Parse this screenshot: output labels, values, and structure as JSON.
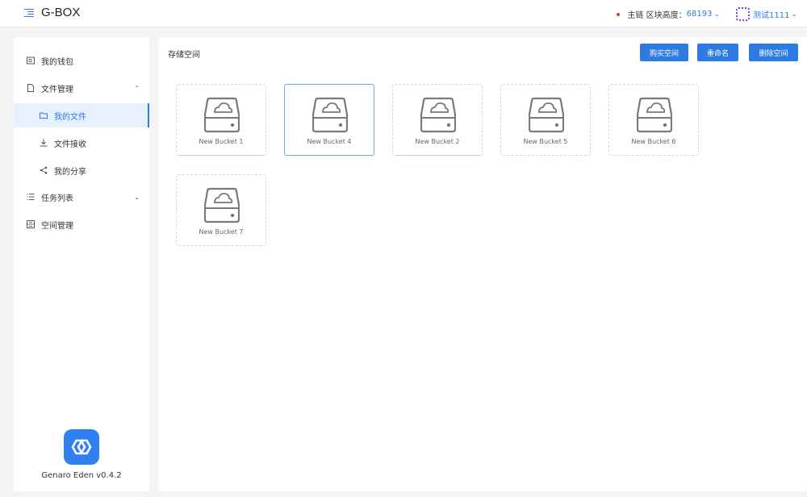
{
  "header": {
    "app_title": "G-BOX",
    "block_height_label": "主链 区块高度：",
    "block_height_value": "68193",
    "user_name": "测试1111"
  },
  "sidebar": {
    "items": [
      {
        "label": "我的钱包",
        "icon": "wallet-icon"
      },
      {
        "label": "文件管理",
        "icon": "file-icon",
        "expanded": true
      },
      {
        "label": "我的文件",
        "icon": "folder-icon",
        "active": true
      },
      {
        "label": "文件接收",
        "icon": "download-icon"
      },
      {
        "label": "我的分享",
        "icon": "share-icon"
      },
      {
        "label": "任务列表",
        "icon": "list-icon",
        "expanded": false
      },
      {
        "label": "空间管理",
        "icon": "storage-icon"
      }
    ],
    "version": "Genaro Eden v0.4.2"
  },
  "main": {
    "title": "存储空间",
    "buttons": {
      "buy": "购买空间",
      "rename": "重命名",
      "delete": "删除空间"
    },
    "buckets": [
      {
        "name": "New Bucket 1"
      },
      {
        "name": "New Bucket 4",
        "selected": true
      },
      {
        "name": "New Bucket 2"
      },
      {
        "name": "New Bucket 5"
      },
      {
        "name": "New Bucket 6"
      },
      {
        "name": "New Bucket 7"
      }
    ]
  },
  "colors": {
    "accent": "#2d7be0",
    "active_bg": "#e6f1fd",
    "status_dot": "#e53935",
    "avatar_border": "#7b3fe4"
  }
}
